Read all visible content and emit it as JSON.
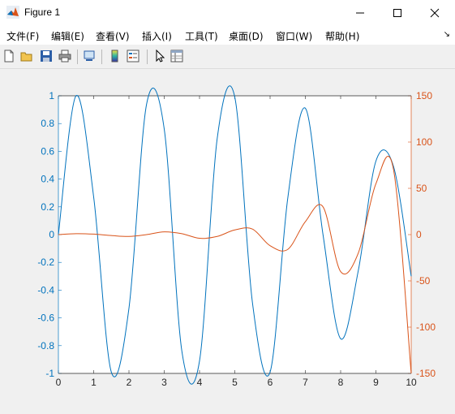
{
  "window": {
    "title": "Figure 1"
  },
  "menu": {
    "items": [
      {
        "label": "文件(F)"
      },
      {
        "label": "编辑(E)"
      },
      {
        "label": "查看(V)"
      },
      {
        "label": "插入(I)"
      },
      {
        "label": "工具(T)"
      },
      {
        "label": "桌面(D)"
      },
      {
        "label": "窗口(W)"
      },
      {
        "label": "帮助(H)"
      }
    ]
  },
  "toolbar": {
    "buttons": [
      "new-figure-icon",
      "open-file-icon",
      "save-icon",
      "print-icon",
      "link-plot-icon",
      "insert-colorbar-icon",
      "insert-legend-icon",
      "pointer-icon",
      "property-inspector-icon"
    ]
  },
  "colors": {
    "left_series": "#0072bd",
    "right_series": "#d95319",
    "axis": "#262626"
  },
  "chart_data": {
    "type": "line",
    "x_ticks": [
      "0",
      "1",
      "2",
      "3",
      "4",
      "5",
      "6",
      "7",
      "8",
      "9",
      "10"
    ],
    "xlim": [
      0,
      10
    ],
    "yleft_ticks": [
      "1",
      "0.8",
      "0.6",
      "0.4",
      "0.2",
      "0",
      "-0.2",
      "-0.4",
      "-0.6",
      "-0.8",
      "-1"
    ],
    "yleft_lim": [
      -1,
      1
    ],
    "yright_ticks": [
      "150",
      "100",
      "50",
      "0",
      "-50",
      "-100",
      "-150"
    ],
    "yright_lim": [
      -150,
      150
    ],
    "grid": false,
    "series": [
      {
        "axis": "left",
        "color": "#0072bd",
        "x": [
          0,
          0.5,
          1,
          1.5,
          2,
          2.5,
          3,
          3.5,
          4,
          4.5,
          5,
          5.5,
          6,
          6.5,
          7,
          7.5,
          8,
          8.5,
          9,
          9.5,
          10
        ],
        "y": [
          0,
          1,
          0.27,
          -0.99,
          -0.53,
          0.94,
          0.76,
          -0.84,
          -0.91,
          0.69,
          0.99,
          -0.49,
          -0.99,
          0.26,
          0.91,
          0,
          -0.75,
          -0.26,
          0.53,
          0.49,
          -0.3
        ]
      },
      {
        "axis": "right",
        "color": "#d95319",
        "x": [
          0,
          0.5,
          1,
          1.5,
          2,
          2.5,
          3,
          3.5,
          4,
          4.5,
          5,
          5.5,
          6,
          6.5,
          7,
          7.5,
          8,
          8.5,
          9,
          9.5,
          10
        ],
        "y": [
          0,
          1,
          0.5,
          -1,
          -2,
          0,
          3,
          1,
          -4,
          -2,
          5,
          6,
          -12,
          -16,
          14,
          30,
          -40,
          -20,
          55,
          70,
          -150
        ]
      }
    ]
  }
}
